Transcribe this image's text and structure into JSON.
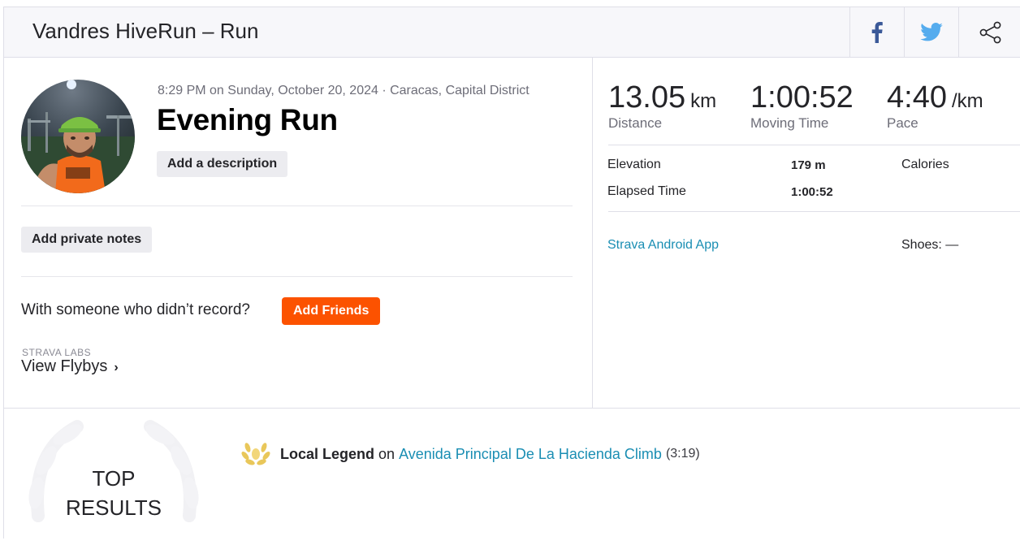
{
  "header": {
    "title": "Vandres HiveRun – Run",
    "share_icons": [
      "facebook-icon",
      "twitter-icon",
      "share-icon"
    ]
  },
  "activity": {
    "meta": "8:29 PM on Sunday, October 20, 2024 · Caracas, Capital District",
    "name": "Evening Run",
    "add_description_label": "Add a description",
    "add_private_notes_label": "Add private notes",
    "with_someone_text": "With someone who didn’t record?",
    "add_friends_label": "Add Friends",
    "labs_label": "STRAVA LABS",
    "flybys_label": "View Flybys",
    "flybys_chevron": "›"
  },
  "stats": {
    "distance": {
      "value": "13.05",
      "unit": "km",
      "label": "Distance"
    },
    "moving_time": {
      "value": "1:00:52",
      "label": "Moving Time"
    },
    "pace": {
      "value": "4:40",
      "unit": "/km",
      "label": "Pace"
    },
    "elevation_label": "Elevation",
    "elevation_value": "179 m",
    "calories_label": "Calories",
    "elapsed_label": "Elapsed Time",
    "elapsed_value": "1:00:52",
    "device": "Strava Android App",
    "shoes": "Shoes: —"
  },
  "results": {
    "badge_line1": "TOP",
    "badge_line2": "RESULTS",
    "legend_label": "Local Legend",
    "on_text": "on",
    "segment_name": "Avenida Principal De La Hacienda Climb",
    "segment_time": "(3:19)"
  },
  "colors": {
    "accent_orange": "#fc5200",
    "link_blue": "#1a8eb3",
    "facebook_blue": "#3b5998",
    "twitter_blue": "#55acee",
    "legend_gold": "#e9c75a"
  }
}
